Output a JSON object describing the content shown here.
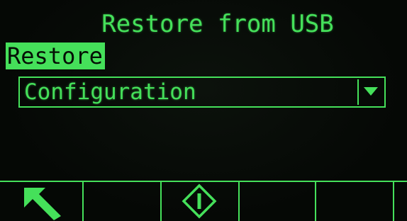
{
  "screen": {
    "title": "Restore from USB"
  },
  "section": {
    "label": "Restore"
  },
  "restore_select": {
    "selected_value": "Configuration",
    "arrow_icon": "down-triangle-icon"
  },
  "softkeys": [
    {
      "icon": "exit-arrow-icon"
    },
    {
      "icon": ""
    },
    {
      "icon": "start-diamond-icon"
    },
    {
      "icon": ""
    },
    {
      "icon": ""
    },
    {
      "icon": ""
    }
  ],
  "colors": {
    "background": "#050805",
    "display_green": "#45e05a",
    "highlight_text": "#051005"
  }
}
